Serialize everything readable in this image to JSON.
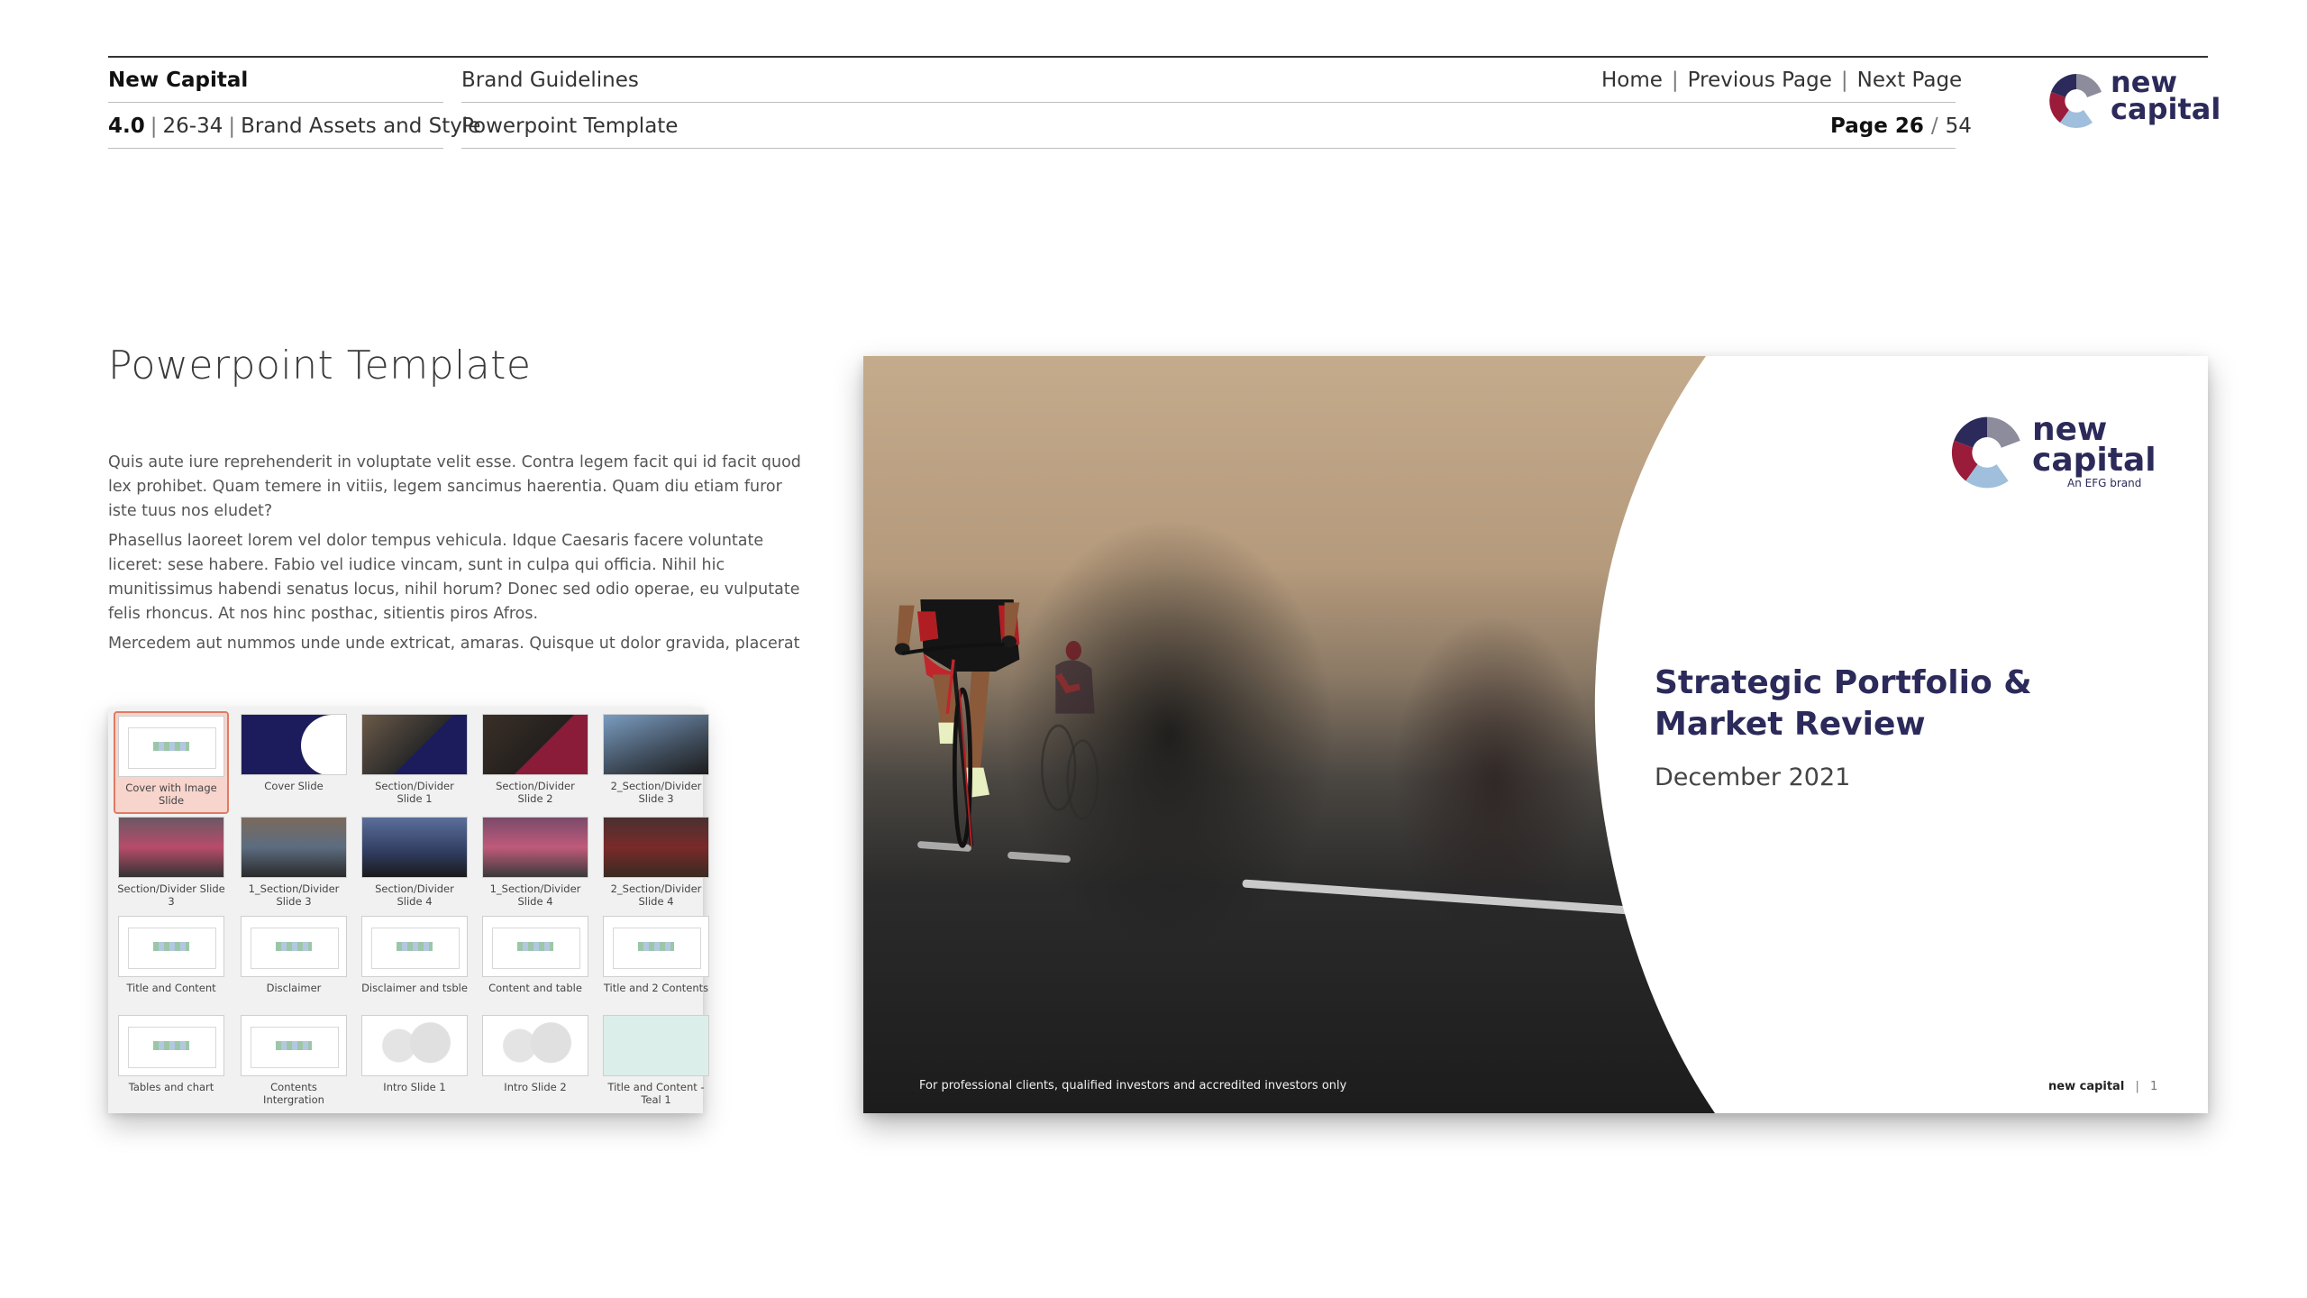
{
  "header": {
    "brand": "New Capital",
    "section_number": "4.0",
    "section_pages": "26-34",
    "section_name": "Brand Assets and Style",
    "doc_title": "Brand Guidelines",
    "subsection": "Powerpoint Template",
    "nav": {
      "home": "Home",
      "previous": "Previous Page",
      "next": "Next Page",
      "separator": "|"
    },
    "page_label": "Page 26",
    "page_total": "54",
    "logo_line1": "new",
    "logo_line2": "capital"
  },
  "main": {
    "title": "Powerpoint Template",
    "paragraphs": [
      "Quis aute iure reprehenderit in voluptate velit esse. Contra legem facit qui id facit quod lex prohibet. Quam temere in vitiis, legem sancimus haerentia. Quam diu etiam furor iste tuus nos eludet?",
      "Phasellus laoreet lorem vel dolor tempus vehicula. Idque Caesaris facere voluntate liceret: sese habere. Fabio vel iudice vincam, sunt in culpa qui officia. Nihil hic munitissimus habendi senatus locus, nihil horum? Donec sed odio operae, eu vulputate felis rhoncus. At nos hinc posthac, sitientis piros Afros.",
      "Mercedem aut nummos unde unde extricat, amaras. Quisque ut dolor gravida, placerat"
    ]
  },
  "thumbnails": [
    {
      "label": "Cover with Image Slide",
      "style": "doc",
      "selected": true
    },
    {
      "label": "Cover Slide",
      "style": "navy"
    },
    {
      "label": "Section/Divider Slide 1",
      "style": "photo1"
    },
    {
      "label": "Section/Divider Slide 2",
      "style": "photo2"
    },
    {
      "label": "2_Section/Divider Slide 3",
      "style": "photo3"
    },
    {
      "label": "Section/Divider Slide 3",
      "style": "photo4"
    },
    {
      "label": "1_Section/Divider Slide 3",
      "style": "photo5"
    },
    {
      "label": "Section/Divider Slide 4",
      "style": "photo6"
    },
    {
      "label": "1_Section/Divider Slide 4",
      "style": "photo7"
    },
    {
      "label": "2_Section/Divider Slide 4",
      "style": "photo8"
    },
    {
      "label": "Title and Content",
      "style": "doc"
    },
    {
      "label": "Disclaimer",
      "style": "doc"
    },
    {
      "label": "Disclaimer and tsble",
      "style": "doc"
    },
    {
      "label": "Content and table",
      "style": "doc"
    },
    {
      "label": "Title and 2 Contents",
      "style": "doc"
    },
    {
      "label": "Tables and chart",
      "style": "doc"
    },
    {
      "label": "Contents Intergration",
      "style": "doc"
    },
    {
      "label": "Intro Slide 1",
      "style": "map"
    },
    {
      "label": "Intro Slide 2",
      "style": "map"
    },
    {
      "label": "Title and Content - Teal 1",
      "style": "teal"
    }
  ],
  "slide": {
    "logo_line1": "new",
    "logo_line2": "capital",
    "tagline": "An EFG brand",
    "title": "Strategic Portfolio & Market Review",
    "date": "December 2021",
    "disclaimer": "For professional clients, qualified investors and accredited investors only",
    "footer_brand": "new capital",
    "footer_separator": "|",
    "footer_page": "1"
  },
  "colors": {
    "brand_navy": "#2b2a5a",
    "brand_red": "#9b1b3a",
    "brand_light_blue": "#9fbfdc",
    "brand_grey": "#8c8c9c",
    "selection": "#e07b63"
  }
}
